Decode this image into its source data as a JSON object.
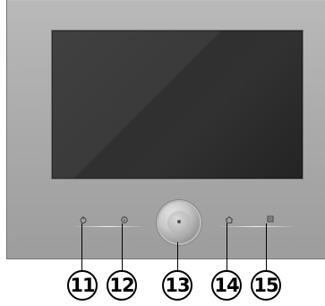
{
  "callouts": [
    {
      "label": "11"
    },
    {
      "label": "12"
    },
    {
      "label": "13"
    },
    {
      "label": "14"
    },
    {
      "label": "15"
    }
  ],
  "icons": {
    "button_11": "power-icon",
    "button_12": "info-icon",
    "button_13": "rotary-knob",
    "button_14": "home-icon",
    "button_15": "menu-icon"
  },
  "colors": {
    "panel": "#a9a9a9",
    "screen": "#2d2d2d",
    "callout_stroke": "#000000"
  }
}
